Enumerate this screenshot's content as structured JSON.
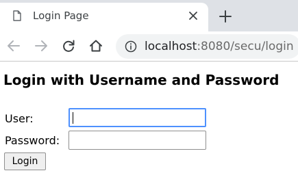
{
  "browser": {
    "tab": {
      "title": "Login Page",
      "icon": "page-icon",
      "close_icon": "close-icon"
    },
    "new_tab_icon": "plus-icon",
    "nav": {
      "back_icon": "arrow-left-icon",
      "forward_icon": "arrow-right-icon",
      "reload_icon": "reload-icon",
      "home_icon": "home-icon"
    },
    "address": {
      "info_icon": "info-icon",
      "host": "localhost",
      "rest": ":8080/secu/login"
    },
    "colors": {
      "tabstrip": "#dee1e6",
      "omnibox": "#f1f3f4",
      "focus": "#4d90fe"
    }
  },
  "page": {
    "title": "Login with Username and Password",
    "form": {
      "user_label": "User:",
      "user_value": "",
      "password_label": "Password:",
      "password_value": "",
      "submit_label": "Login"
    }
  }
}
